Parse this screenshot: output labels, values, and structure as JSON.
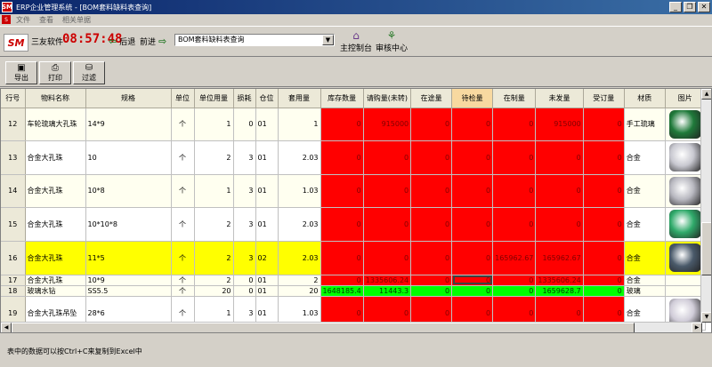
{
  "window": {
    "title": "ERP企业管理系统 - [BOM套料缺料表查询]"
  },
  "menu": {
    "items": [
      "文件",
      "查看",
      "相关单据"
    ]
  },
  "header": {
    "logo_text": "SM",
    "brand": "三友软件",
    "clock": "08:57:48",
    "back_label": "后退",
    "forward_label": "前进",
    "combo_value": "BOM套料缺料表查询",
    "console_label": "主控制台",
    "audit_label": "审核中心"
  },
  "toolbar": {
    "export_label": "导出",
    "print_label": "打印",
    "filter_label": "过滤"
  },
  "grid": {
    "columns": [
      "行号",
      "物料名称",
      "规格",
      "单位",
      "单位用量",
      "损耗",
      "仓位",
      "套用量",
      "库存数量",
      "请购量(未转)",
      "在途量",
      "待检量",
      "在制量",
      "未发量",
      "受订量",
      "材质",
      "图片"
    ],
    "rows": [
      {
        "no": "12",
        "name": "车轮琉璃大孔珠",
        "spec": "14*9",
        "unit": "个",
        "qty": "1",
        "loss": "0",
        "loc": "01",
        "set": "1",
        "stock": "0",
        "req": "915000",
        "transit": "0",
        "check": "0",
        "wip": "0",
        "unsent": "915000",
        "order": "0",
        "material": "手工琉璃",
        "bead": "#1f7a3a"
      },
      {
        "no": "13",
        "name": "合金大孔珠",
        "spec": "10",
        "unit": "个",
        "qty": "2",
        "loss": "3",
        "loc": "01",
        "set": "2.03",
        "stock": "0",
        "req": "0",
        "transit": "0",
        "check": "0",
        "wip": "0",
        "unsent": "0",
        "order": "0",
        "material": "合金",
        "bead": "#c8c8d0"
      },
      {
        "no": "14",
        "name": "合金大孔珠",
        "spec": "10*8",
        "unit": "个",
        "qty": "1",
        "loss": "3",
        "loc": "01",
        "set": "1.03",
        "stock": "0",
        "req": "0",
        "transit": "0",
        "check": "0",
        "wip": "0",
        "unsent": "0",
        "order": "0",
        "material": "合金",
        "bead": "#b8b8c0"
      },
      {
        "no": "15",
        "name": "合金大孔珠",
        "spec": "10*10*8",
        "unit": "个",
        "qty": "2",
        "loss": "3",
        "loc": "01",
        "set": "2.03",
        "stock": "0",
        "req": "0",
        "transit": "0",
        "check": "0",
        "wip": "0",
        "unsent": "0",
        "order": "0",
        "material": "合金",
        "bead": "#2faa6a"
      },
      {
        "no": "16",
        "name": "合金大孔珠",
        "spec": "11*5",
        "unit": "个",
        "qty": "2",
        "loss": "3",
        "loc": "02",
        "set": "2.03",
        "stock": "0",
        "req": "0",
        "transit": "0",
        "check": "0",
        "wip": "165962.67",
        "unsent": "165962.67",
        "order": "0",
        "material": "合金",
        "bead": "#4a5a6a"
      },
      {
        "no": "17",
        "name": "合金大孔珠",
        "spec": "10*9",
        "unit": "个",
        "qty": "2",
        "loss": "0",
        "loc": "01",
        "set": "2",
        "stock": "0",
        "req": "1335606.24",
        "transit": "0",
        "check": "0",
        "wip": "0",
        "unsent": "1335606.24",
        "order": "0",
        "material": "合金",
        "bead": ""
      },
      {
        "no": "18",
        "name": "玻璃水钻",
        "spec": "SS5.5",
        "unit": "个",
        "qty": "20",
        "loss": "0",
        "loc": "01",
        "set": "20",
        "stock": "1648185.4",
        "req": "11443.3",
        "transit": "0",
        "check": "0",
        "wip": "0",
        "unsent": "1659628.7",
        "order": "0",
        "material": "玻璃",
        "bead": ""
      },
      {
        "no": "19",
        "name": "合金大孔珠吊坠",
        "spec": "28*6",
        "unit": "个",
        "qty": "1",
        "loss": "3",
        "loc": "01",
        "set": "1.03",
        "stock": "0",
        "req": "0",
        "transit": "0",
        "check": "0",
        "wip": "0",
        "unsent": "0",
        "order": "0",
        "material": "合金",
        "bead": "#d0ccd8"
      }
    ]
  },
  "status": {
    "text": "表中的数据可以按Ctrl+C来复制到Excel中"
  },
  "colors": {
    "shortage": "#ff0000",
    "ok": "#00ff00",
    "highlight": "#ffff00"
  }
}
